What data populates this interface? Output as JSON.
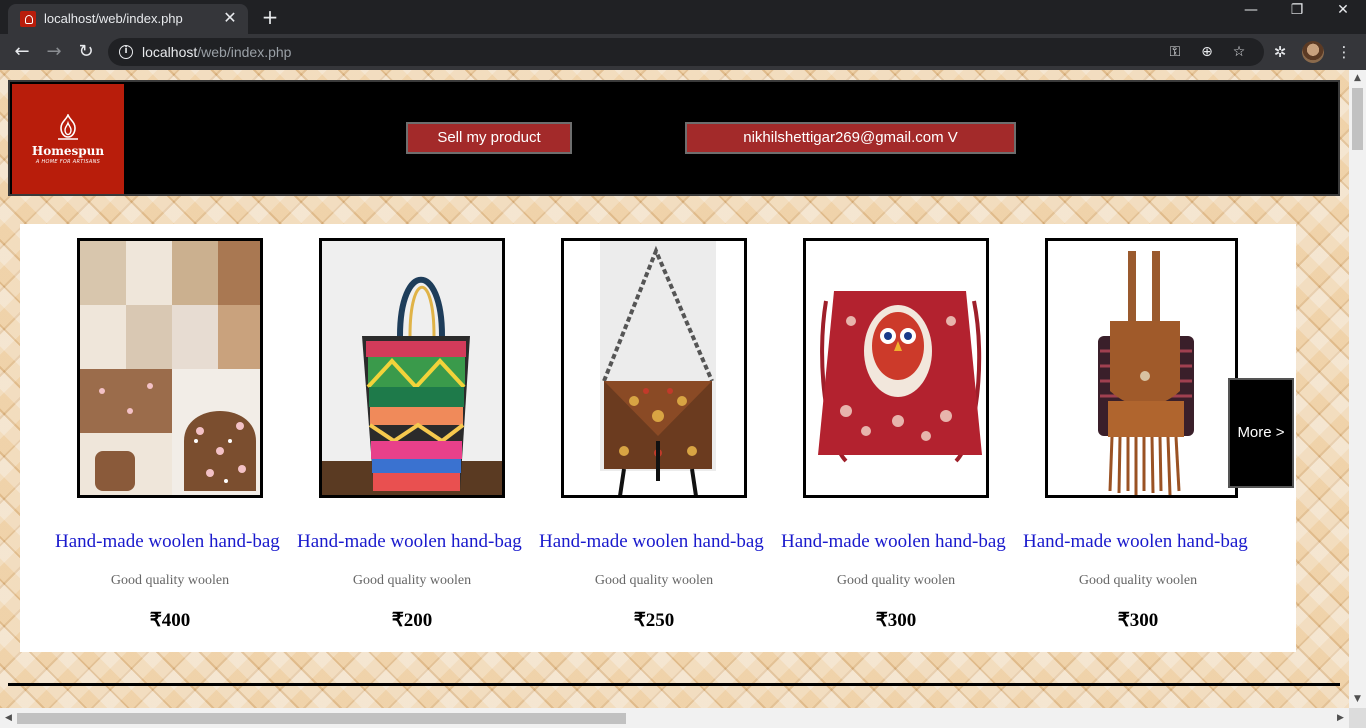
{
  "browser": {
    "tab_title": "localhost/web/index.php",
    "tab_close": "✕",
    "new_tab": "+",
    "url_host": "localhost",
    "url_path": "/web/index.php",
    "window_minimize": "—",
    "window_restore": "❐",
    "window_close": "✕"
  },
  "header": {
    "logo_name": "Homespun",
    "logo_tagline": "A HOME FOR ARTISANS",
    "sell_button": "Sell my product",
    "account_button": "nikhilshettigar269@gmail.com V",
    "brand_color": "#b81d0b",
    "button_color": "#a32a2a"
  },
  "products": [
    {
      "title": "Hand-made woolen hand-bag",
      "description": "Good quality woolen",
      "price": "₹400",
      "image": "craft-steps-photo"
    },
    {
      "title": "Hand-made woolen hand-bag",
      "description": "Good quality woolen",
      "price": "₹200",
      "image": "striped-tote-bag-photo"
    },
    {
      "title": "Hand-made woolen hand-bag",
      "description": "Good quality woolen",
      "price": "₹250",
      "image": "embroidered-sling-bag-photo"
    },
    {
      "title": "Hand-made woolen hand-bag",
      "description": "Good quality woolen",
      "price": "₹300",
      "image": "owl-print-red-bag-photo"
    },
    {
      "title": "Hand-made woolen hand-bag",
      "description": "Good quality woolen",
      "price": "₹300",
      "image": "fringe-backpack-photo"
    }
  ],
  "more_button": "More >",
  "link_color": "#1a1acd"
}
